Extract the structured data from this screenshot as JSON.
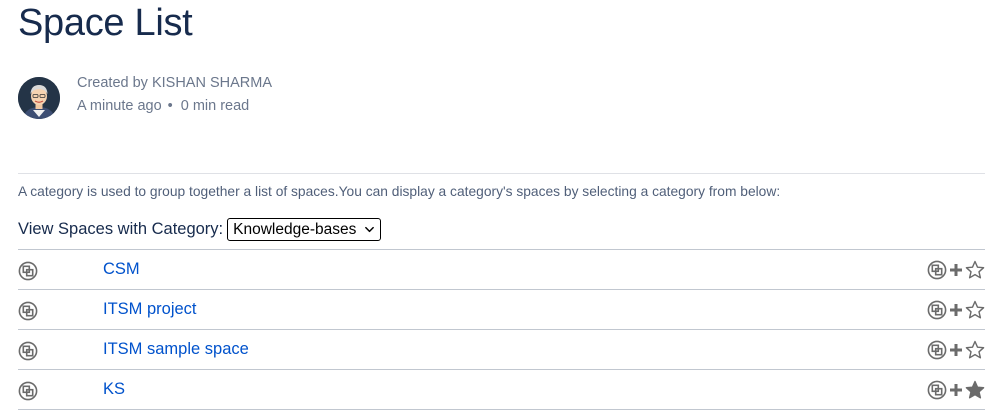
{
  "page": {
    "title": "Space List"
  },
  "byline": {
    "created_by": "Created by KISHAN SHARMA",
    "time_ago": "A minute ago",
    "separator": "•",
    "read_time": "0 min read"
  },
  "description": "A category is used to group together a list of spaces.You can display a category's spaces by selecting a category from below:",
  "filter": {
    "label": "View Spaces with Category:",
    "selected": "Knowledge-bases"
  },
  "spaces": [
    {
      "name": "CSM",
      "favourite": false
    },
    {
      "name": "ITSM project",
      "favourite": false
    },
    {
      "name": "ITSM sample space",
      "favourite": false
    },
    {
      "name": "KS",
      "favourite": true
    }
  ],
  "colors": {
    "link": "#0052cc",
    "title": "#172b4d",
    "meta": "#6b778c",
    "icon": "#6b6b6b"
  }
}
